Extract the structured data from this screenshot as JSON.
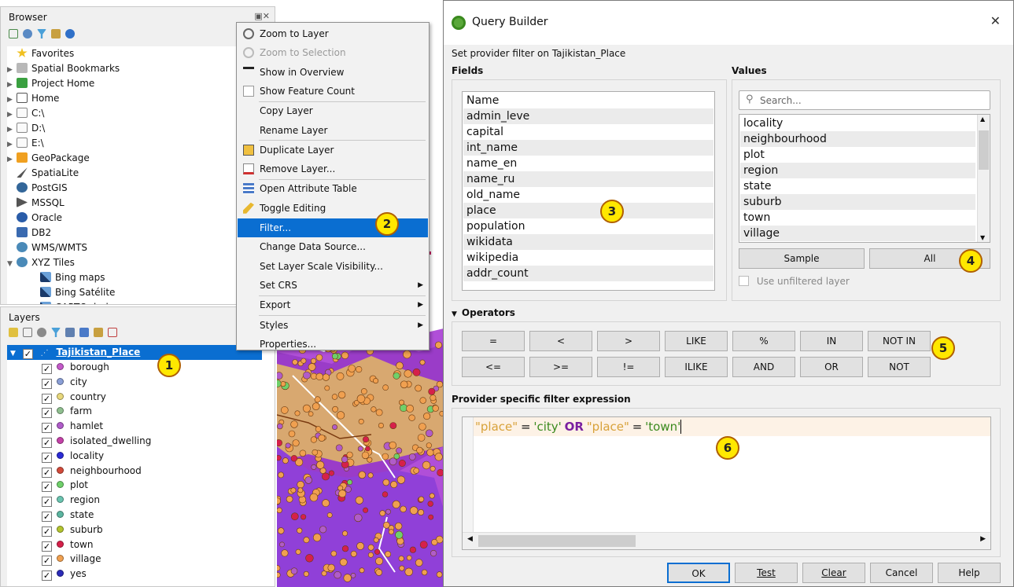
{
  "browser": {
    "title": "Browser",
    "items": [
      {
        "label": "Favorites",
        "icon": "star-icon",
        "arrow": ""
      },
      {
        "label": "Spatial Bookmarks",
        "icon": "bookmarks-icon",
        "arrow": "▶"
      },
      {
        "label": "Project Home",
        "icon": "project-home-icon",
        "arrow": "▶"
      },
      {
        "label": "Home",
        "icon": "home-icon",
        "arrow": "▶"
      },
      {
        "label": "C:\\",
        "icon": "folder-icon",
        "arrow": "▶"
      },
      {
        "label": "D:\\",
        "icon": "folder-icon",
        "arrow": "▶"
      },
      {
        "label": "E:\\",
        "icon": "folder-icon",
        "arrow": "▶"
      },
      {
        "label": "GeoPackage",
        "icon": "geopackage-icon",
        "arrow": "▶"
      },
      {
        "label": "SpatiaLite",
        "icon": "spatialite-icon",
        "arrow": ""
      },
      {
        "label": "PostGIS",
        "icon": "postgis-icon",
        "arrow": ""
      },
      {
        "label": "MSSQL",
        "icon": "mssql-icon",
        "arrow": ""
      },
      {
        "label": "Oracle",
        "icon": "oracle-icon",
        "arrow": ""
      },
      {
        "label": "DB2",
        "icon": "db2-icon",
        "arrow": ""
      },
      {
        "label": "WMS/WMTS",
        "icon": "wms-icon",
        "arrow": ""
      },
      {
        "label": "XYZ Tiles",
        "icon": "xyz-tiles-icon",
        "arrow": "▼"
      },
      {
        "label": "Bing maps",
        "icon": "tile-icon",
        "arrow": ""
      },
      {
        "label": "Bing Satélite",
        "icon": "tile-icon",
        "arrow": ""
      },
      {
        "label": "CARTO dark",
        "icon": "tile-icon",
        "arrow": ""
      }
    ]
  },
  "layers": {
    "title": "Layers",
    "root": {
      "label": "Tajikistan_Place",
      "check": "✓"
    },
    "items": [
      {
        "label": "borough",
        "color": "#c45ac9"
      },
      {
        "label": "city",
        "color": "#8a9fd6"
      },
      {
        "label": "country",
        "color": "#e8d87c"
      },
      {
        "label": "farm",
        "color": "#8fbf8f"
      },
      {
        "label": "hamlet",
        "color": "#b05cc9"
      },
      {
        "label": "isolated_dwelling",
        "color": "#c442a8"
      },
      {
        "label": "locality",
        "color": "#2b2bd6"
      },
      {
        "label": "neighbourhood",
        "color": "#d24a3a"
      },
      {
        "label": "plot",
        "color": "#6fd06a"
      },
      {
        "label": "region",
        "color": "#6ac4b0"
      },
      {
        "label": "state",
        "color": "#5bb5a0"
      },
      {
        "label": "suburb",
        "color": "#b3c42e"
      },
      {
        "label": "town",
        "color": "#d6204a"
      },
      {
        "label": "village",
        "color": "#f0a050"
      },
      {
        "label": "yes",
        "color": "#2b2bb8"
      }
    ]
  },
  "context_menu": {
    "items": [
      {
        "label": "Zoom to Layer",
        "icon": "zoom-layer-icon",
        "state": ""
      },
      {
        "label": "Zoom to Selection",
        "icon": "zoom-selection-icon",
        "state": "dis"
      },
      {
        "label": "Show in Overview",
        "icon": "overview-icon",
        "state": ""
      },
      {
        "label": "Show Feature Count",
        "icon": "checkbox-icon",
        "state": ""
      },
      {
        "label": "Copy Layer",
        "icon": "",
        "state": ""
      },
      {
        "label": "Rename Layer",
        "icon": "",
        "state": ""
      },
      {
        "label": "Duplicate Layer",
        "icon": "duplicate-icon",
        "state": ""
      },
      {
        "label": "Remove Layer...",
        "icon": "remove-layer-icon",
        "state": ""
      },
      {
        "label": "Open Attribute Table",
        "icon": "table-icon",
        "state": ""
      },
      {
        "label": "Toggle Editing",
        "icon": "pencil-icon",
        "state": ""
      },
      {
        "label": "Filter...",
        "icon": "",
        "state": "hl"
      },
      {
        "label": "Change Data Source...",
        "icon": "",
        "state": ""
      },
      {
        "label": "Set Layer Scale Visibility...",
        "icon": "",
        "state": ""
      },
      {
        "label": "Set CRS",
        "icon": "",
        "state": "sub"
      },
      {
        "label": "Export",
        "icon": "",
        "state": "sub"
      },
      {
        "label": "Styles",
        "icon": "",
        "state": "sub"
      },
      {
        "label": "Properties...",
        "icon": "",
        "state": ""
      }
    ]
  },
  "dialog": {
    "title": "Query Builder",
    "close": "✕",
    "subtitle": "Set provider filter on Tajikistan_Place",
    "fields_label": "Fields",
    "fields": [
      "Name",
      "admin_leve",
      "capital",
      "int_name",
      "name_en",
      "name_ru",
      "old_name",
      "place",
      "population",
      "wikidata",
      "wikipedia",
      "addr_count"
    ],
    "values_label": "Values",
    "search_placeholder": "Search...",
    "values": [
      "locality",
      "neighbourhood",
      "plot",
      "region",
      "state",
      "suburb",
      "town",
      "village"
    ],
    "sample_label": "Sample",
    "all_label": "All",
    "unfiltered_label": "Use unfiltered layer",
    "operators_label": "Operators",
    "operators_row1": [
      "=",
      "<",
      ">",
      "LIKE",
      "%",
      "IN",
      "NOT IN"
    ],
    "operators_row2": [
      "<=",
      ">=",
      "!=",
      "ILIKE",
      "AND",
      "OR",
      "NOT"
    ],
    "expression_label": "Provider specific filter expression",
    "expression": {
      "field1": "\"place\"",
      "op1": "=",
      "val1": "'city'",
      "kw": "OR",
      "field2": "\"place\"",
      "op2": "=",
      "val2": "'town'"
    },
    "buttons": {
      "ok": "OK",
      "test": "Test",
      "clear": "Clear",
      "cancel": "Cancel",
      "help": "Help"
    }
  },
  "badges": [
    "1",
    "2",
    "3",
    "4",
    "5",
    "6"
  ],
  "colors": {
    "highlight": "#0a6ed1",
    "badge": "#ffe800",
    "field_token": "#d8a23a",
    "value_token": "#3a8a1e",
    "keyword": "#7a1fa0"
  }
}
